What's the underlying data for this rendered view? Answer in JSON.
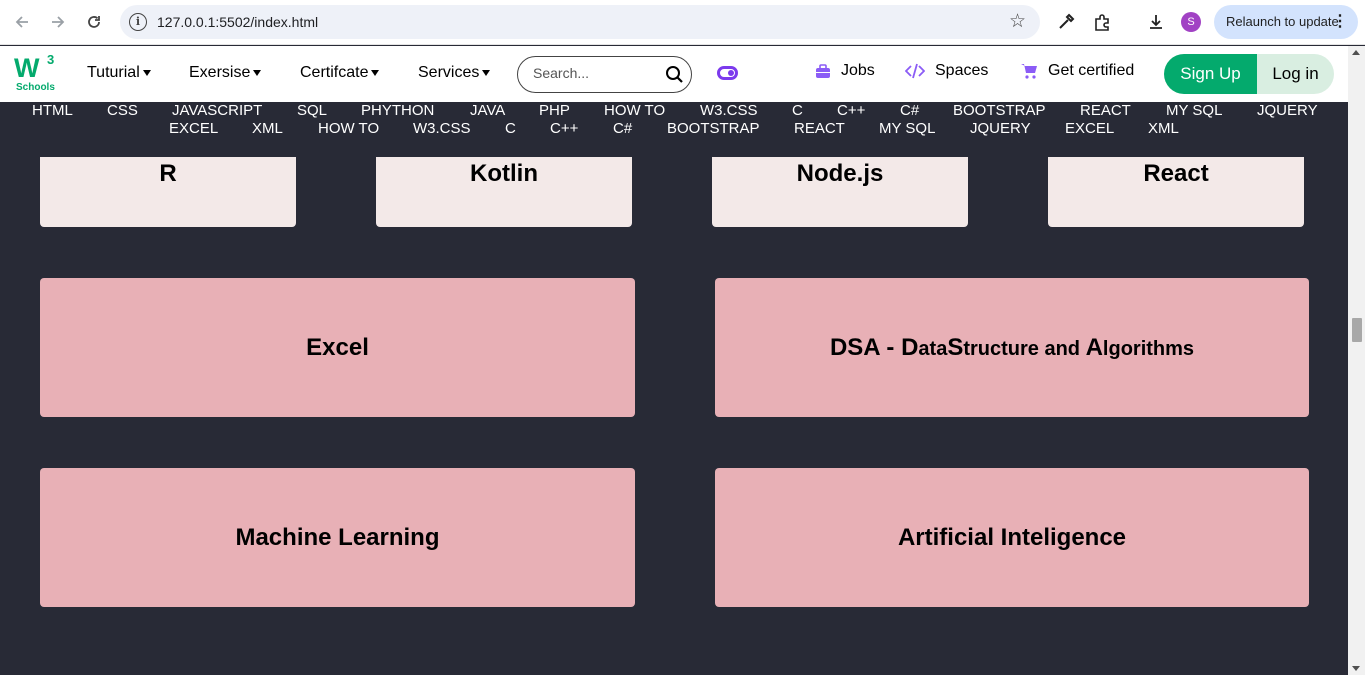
{
  "browser": {
    "url": "127.0.0.1:5502/index.html",
    "relaunch_label": "Relaunch to update",
    "profile_initial": "S"
  },
  "header": {
    "logo_main": "W",
    "logo_sup": "3",
    "logo_sub": "Schools",
    "menu": [
      "Tuturial",
      "Exersise",
      "Certifcate",
      "Services"
    ],
    "search_placeholder": "Search...",
    "links": [
      "Jobs",
      "Spaces",
      "Get certified"
    ],
    "signup": "Sign Up",
    "login": "Log in"
  },
  "topics": {
    "row1": [
      "HTML",
      "CSS",
      "JAVASCRIPT",
      "SQL",
      "PHYTHON",
      "JAVA",
      "PHP",
      "HOW TO",
      "W3.CSS",
      "C",
      "C++",
      "C#",
      "BOOTSTRAP",
      "REACT",
      "MY SQL",
      "JQUERY"
    ],
    "row2": [
      "EXCEL",
      "XML",
      "HOW TO",
      "W3.CSS",
      "C",
      "C++",
      "C#",
      "BOOTSTRAP",
      "REACT",
      "MY SQL",
      "JQUERY",
      "EXCEL",
      "XML"
    ]
  },
  "cards": {
    "small": [
      "R",
      "Kotlin",
      "Node.js",
      "React"
    ],
    "big": [
      "Excel",
      "Machine Learning",
      "Artificial Inteligence"
    ],
    "dsa": {
      "prefix": "DSA - ",
      "d": "D",
      "data": "ata",
      "s": "S",
      "structure": "tructure and ",
      "a": "A",
      "lgorithms": "lgorithms"
    }
  },
  "colors": {
    "background": "#282a36",
    "accent_green": "#04aa6d",
    "card_light": "#f3e9e8",
    "card_pink": "#e8b0b6"
  }
}
